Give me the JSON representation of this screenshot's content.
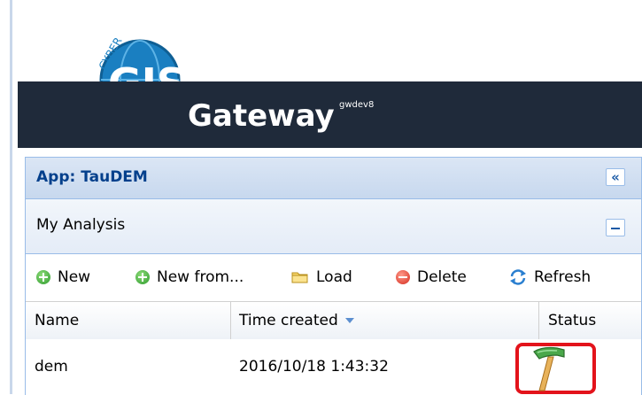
{
  "header": {
    "logo_text": "CyberGIS",
    "title": "Gateway",
    "subtitle": "gwdev8"
  },
  "app": {
    "title": "App: TauDEM",
    "collapse_icon": "double-chevron-left-icon"
  },
  "analysis": {
    "title": "My Analysis",
    "minimize_icon": "minus-icon"
  },
  "toolbar": {
    "new_label": "New",
    "new_from_label": "New from...",
    "load_label": "Load",
    "delete_label": "Delete",
    "refresh_label": "Refresh"
  },
  "grid": {
    "columns": [
      "Name",
      "Time created",
      "Status"
    ],
    "sort_column": "Time created",
    "rows": [
      {
        "name": "dem",
        "time_created": "2016/10/18 1:43:32",
        "status_icon": "hammer-icon"
      }
    ]
  },
  "colors": {
    "banner": "#1f2a3a",
    "header_text": "#04408c",
    "highlight": "#e3131b"
  }
}
